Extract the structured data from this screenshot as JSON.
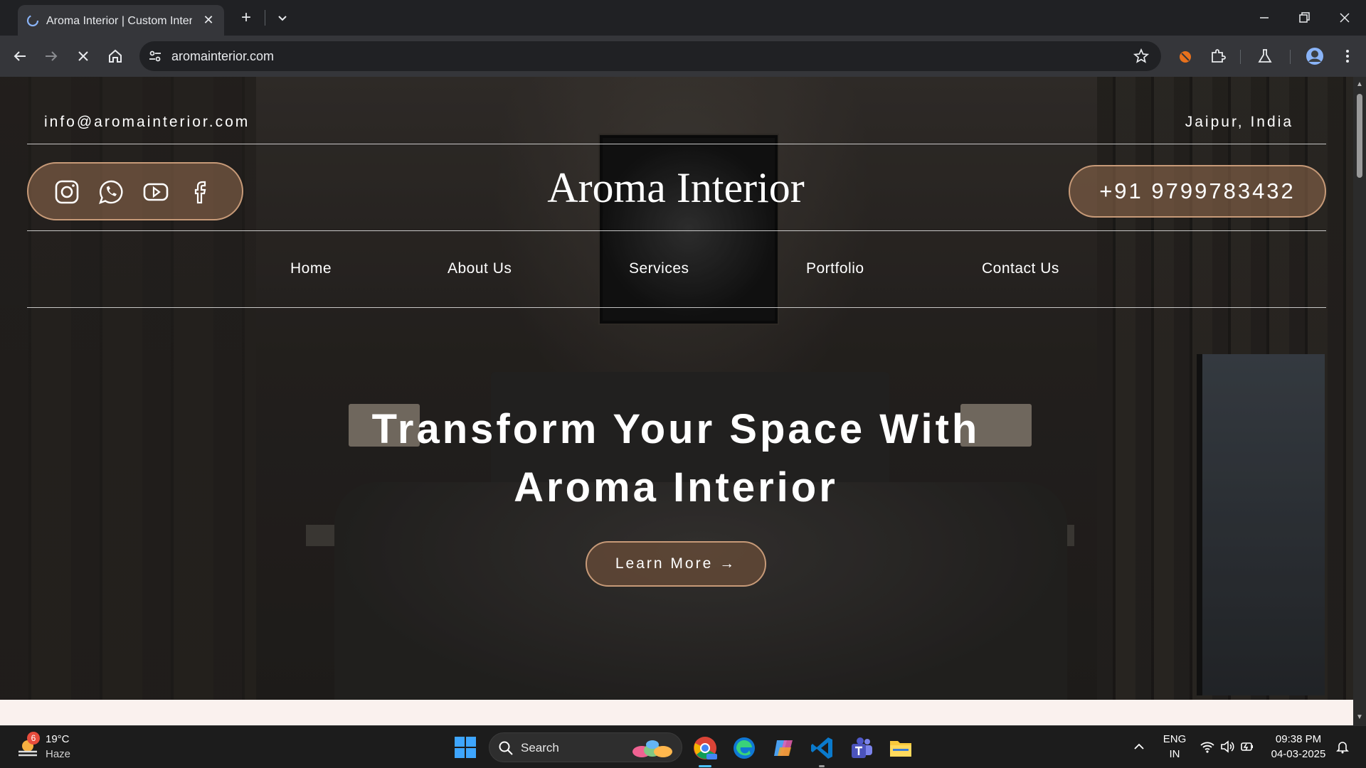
{
  "browser": {
    "tab_title": "Aroma Interior | Custom Interior",
    "url": "aromainterior.com"
  },
  "header": {
    "email": "info@aromainterior.com",
    "location": "Jaipur, India",
    "brand": "Aroma Interior",
    "phone": "+91 9799783432",
    "social": [
      "instagram-icon",
      "whatsapp-icon",
      "youtube-icon",
      "facebook-icon"
    ]
  },
  "nav": {
    "items": [
      {
        "label": "Home"
      },
      {
        "label": "About Us"
      },
      {
        "label": "Services"
      },
      {
        "label": "Portfolio"
      },
      {
        "label": "Contact Us"
      }
    ]
  },
  "hero": {
    "title_line1": "Transform Your Space With",
    "title_line2": "Aroma Interior",
    "cta": "Learn More →"
  },
  "taskbar": {
    "weather_temp": "19°C",
    "weather_desc": "Haze",
    "weather_badge": "6",
    "search_placeholder": "Search",
    "lang_top": "ENG",
    "lang_bottom": "IN",
    "time": "09:38 PM",
    "date": "04-03-2025"
  },
  "colors": {
    "accent": "#c79a78",
    "button_fill": "#966e50"
  }
}
